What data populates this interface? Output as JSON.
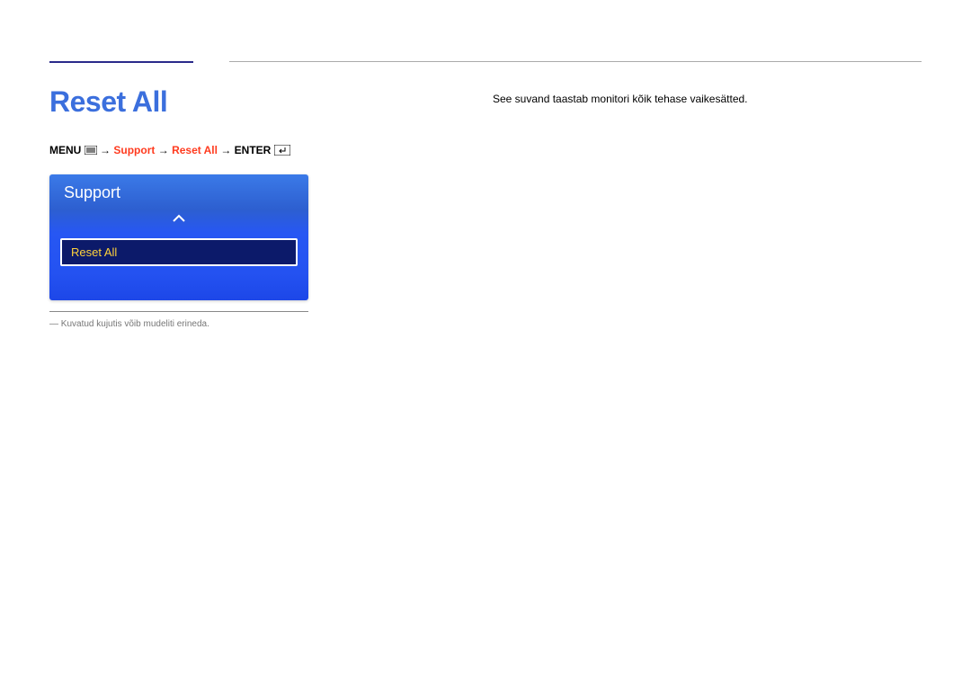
{
  "heading": "Reset All",
  "breadcrumb": {
    "menu": "MENU",
    "arrow": "→",
    "support": "Support",
    "reset_all": "Reset All",
    "enter": "ENTER"
  },
  "osd": {
    "header": "Support",
    "item": "Reset All"
  },
  "footnote": "― Kuvatud kujutis võib mudeliti erineda.",
  "description": "See suvand taastab monitori kõik tehase vaikesätted."
}
